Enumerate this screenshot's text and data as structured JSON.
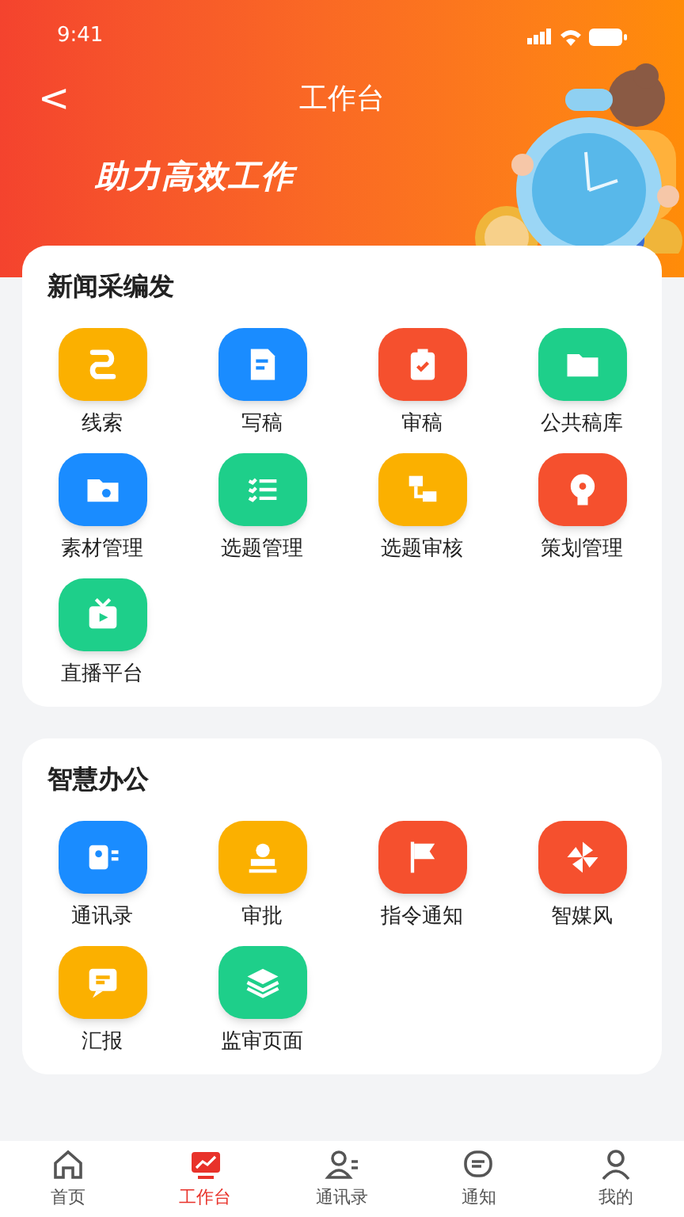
{
  "status_bar": {
    "time": "9:41"
  },
  "nav": {
    "back": "<",
    "title": "工作台"
  },
  "banner": {
    "slogan": "助力高效工作"
  },
  "sections": [
    {
      "title": "新闻采编发",
      "items": [
        {
          "label": "线索",
          "color": "#fbb000"
        },
        {
          "label": "写稿",
          "color": "#1a8cff"
        },
        {
          "label": "审稿",
          "color": "#f5502e"
        },
        {
          "label": "公共稿库",
          "color": "#1ecf8a"
        },
        {
          "label": "素材管理",
          "color": "#1a8cff"
        },
        {
          "label": "选题管理",
          "color": "#1ecf8a"
        },
        {
          "label": "选题审核",
          "color": "#fbb000"
        },
        {
          "label": "策划管理",
          "color": "#f5502e"
        },
        {
          "label": "直播平台",
          "color": "#1ecf8a"
        }
      ]
    },
    {
      "title": "智慧办公",
      "items": [
        {
          "label": "通讯录",
          "color": "#1a8cff"
        },
        {
          "label": "审批",
          "color": "#fbb000"
        },
        {
          "label": "指令通知",
          "color": "#f5502e"
        },
        {
          "label": "智媒风",
          "color": "#f5502e"
        },
        {
          "label": "汇报",
          "color": "#fbb000"
        },
        {
          "label": "监审页面",
          "color": "#1ecf8a"
        }
      ]
    }
  ],
  "tab_bar": [
    {
      "label": "首页",
      "selected": false
    },
    {
      "label": "工作台",
      "selected": true
    },
    {
      "label": "通讯录",
      "selected": false
    },
    {
      "label": "通知",
      "selected": false
    },
    {
      "label": "我的",
      "selected": false
    }
  ]
}
